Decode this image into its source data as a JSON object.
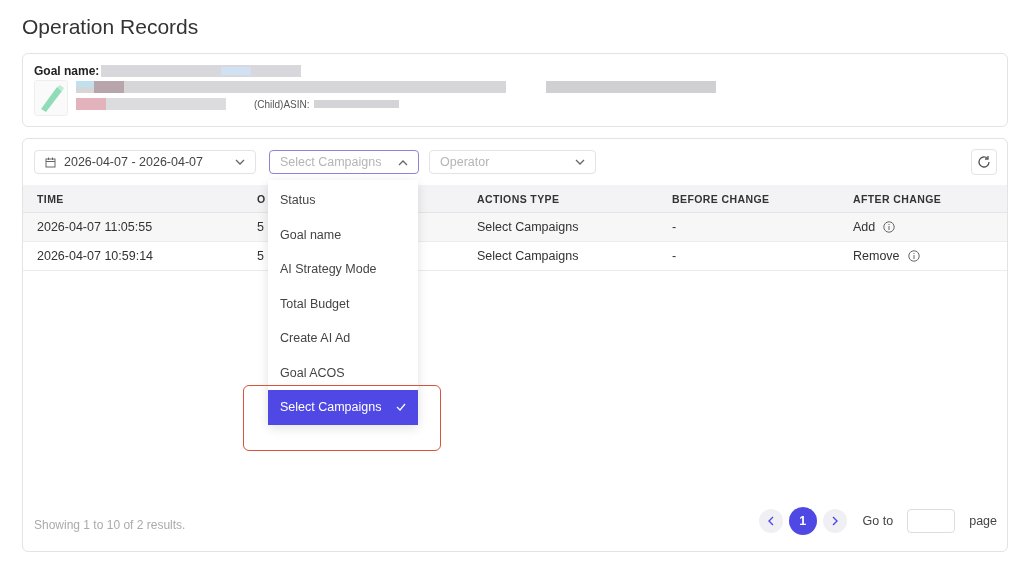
{
  "page_title": "Operation Records",
  "goal": {
    "label": "Goal name:",
    "asin_label": "(Child)ASIN:"
  },
  "filters": {
    "date_range": "2026-04-07 - 2026-04-07",
    "campaign_filter": {
      "placeholder": "Select Campaigns",
      "expanded": true
    },
    "operator": {
      "placeholder": "Operator"
    }
  },
  "table": {
    "columns": [
      "TIME",
      "O",
      "ACTIONS TYPE",
      "BEFORE CHANGE",
      "AFTER CHANGE"
    ],
    "rows": [
      {
        "cells": [
          "2026-04-07 11:05:55",
          "5",
          "Select Campaigns",
          "-",
          "Add"
        ],
        "highlighted": true
      },
      {
        "cells": [
          "2026-04-07 10:59:14",
          "5",
          "Select Campaigns",
          "-",
          "Remove"
        ],
        "highlighted": false
      }
    ]
  },
  "dropdown": {
    "options": [
      {
        "label": "Status",
        "selected": false
      },
      {
        "label": "Goal name",
        "selected": false
      },
      {
        "label": "AI Strategy Mode",
        "selected": false
      },
      {
        "label": "Total Budget",
        "selected": false
      },
      {
        "label": "Create AI Ad",
        "selected": false
      },
      {
        "label": "Goal ACOS",
        "selected": false
      },
      {
        "label": "Select Campaigns",
        "selected": true
      }
    ]
  },
  "footer": {
    "summary": "Showing 1 to 10 of 2 results.",
    "pages": [
      {
        "label": "1",
        "selected": true
      }
    ],
    "goto_label": "Go to",
    "page_label": "page"
  }
}
